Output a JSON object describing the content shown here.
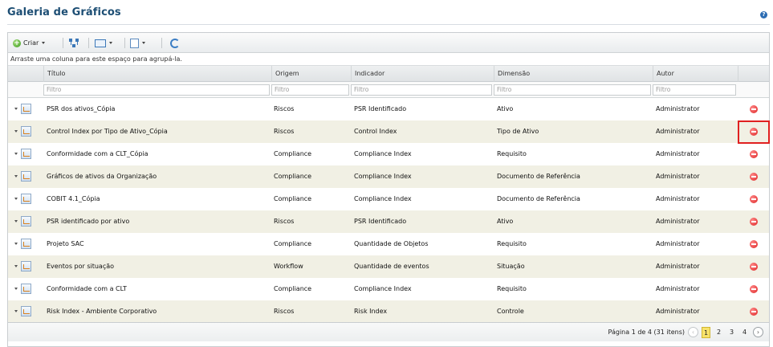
{
  "page": {
    "title": "Galeria de Gráficos",
    "help_icon": "help-icon"
  },
  "toolbar": {
    "create_label": "Criar",
    "icons": [
      "add-icon",
      "tree-icon",
      "grid-layout-icon",
      "export-icon",
      "refresh-icon"
    ]
  },
  "group_hint": "Arraste uma coluna para este espaço para agrupá-la.",
  "columns": [
    "Título",
    "Origem",
    "Indicador",
    "Dimensão",
    "Autor"
  ],
  "filter_placeholder": "Filtro",
  "rows": [
    {
      "title": "PSR dos ativos_Cópia",
      "origin": "Riscos",
      "indicator": "PSR Identificado",
      "dimension": "Ativo",
      "author": "Administrator"
    },
    {
      "title": "Control Index por Tipo de Ativo_Cópia",
      "origin": "Riscos",
      "indicator": "Control Index",
      "dimension": "Tipo de Ativo",
      "author": "Administrator"
    },
    {
      "title": "Conformidade com a CLT_Cópia",
      "origin": "Compliance",
      "indicator": "Compliance Index",
      "dimension": "Requisito",
      "author": "Administrator"
    },
    {
      "title": "Gráficos de ativos da Organização",
      "origin": "Compliance",
      "indicator": "Compliance Index",
      "dimension": "Documento de Referência",
      "author": "Administrator"
    },
    {
      "title": "COBIT 4.1_Cópia",
      "origin": "Compliance",
      "indicator": "Compliance Index",
      "dimension": "Documento de Referência",
      "author": "Administrator"
    },
    {
      "title": "PSR identificado por ativo",
      "origin": "Riscos",
      "indicator": "PSR Identificado",
      "dimension": "Ativo",
      "author": "Administrator"
    },
    {
      "title": "Projeto SAC",
      "origin": "Compliance",
      "indicator": "Quantidade de Objetos",
      "dimension": "Requisito",
      "author": "Administrator"
    },
    {
      "title": "Eventos por situação",
      "origin": "Workflow",
      "indicator": "Quantidade de eventos",
      "dimension": "Situação",
      "author": "Administrator"
    },
    {
      "title": "Conformidade com a CLT",
      "origin": "Compliance",
      "indicator": "Compliance Index",
      "dimension": "Requisito",
      "author": "Administrator"
    },
    {
      "title": "Risk Index - Ambiente Corporativo",
      "origin": "Riscos",
      "indicator": "Risk Index",
      "dimension": "Controle",
      "author": "Administrator"
    }
  ],
  "pager": {
    "info": "Página 1 de 4 (31 itens)",
    "pages": [
      "1",
      "2",
      "3",
      "4"
    ],
    "prev": "‹",
    "next": "›"
  },
  "colors": {
    "title": "#1d4e74",
    "alt_row": "#f1f0e4",
    "delete": "#dd2222",
    "highlight": "#e02020",
    "current_page": "#f7e26b"
  }
}
